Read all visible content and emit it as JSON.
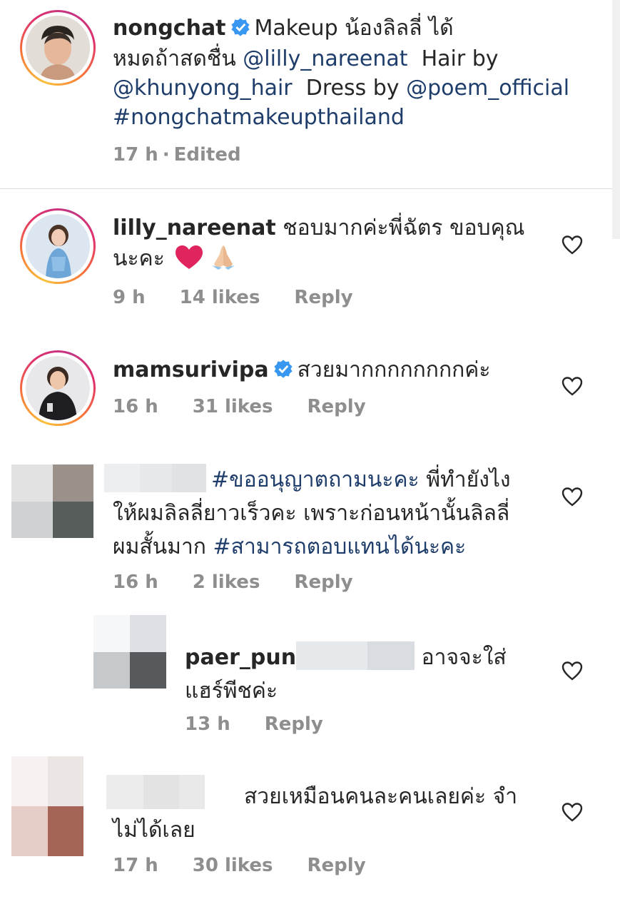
{
  "post": {
    "username": "nongchat",
    "caption_1": "Makeup น้องลิลลี่ ได้",
    "caption_2": "หมดถ้าสดชื่น",
    "mention_1": "@lilly_nareenat",
    "caption_3": "Hair by",
    "mention_2": "@khunyong_hair",
    "caption_4": "Dress by",
    "mention_3": "@poem_official",
    "hashtag": "#nongchatmakeupthailand",
    "time": "17 h",
    "separator": "·",
    "edited": "Edited"
  },
  "comments": [
    {
      "username": "lilly_nareenat",
      "line_1": "ชอบมากค่ะพี่ฉัตร ขอบคุณ",
      "line_2": "นะคะ",
      "emoji_1": "❤️",
      "emoji_2": "🙏🏻",
      "time": "9 h",
      "likes": "14 likes",
      "reply": "Reply"
    },
    {
      "username": "mamsurivipa",
      "text": "สวยมากกกกกกกกค่ะ",
      "time": "16 h",
      "likes": "31 likes",
      "reply": "Reply"
    },
    {
      "hashtag_1": "#ขออนุญาตถามนะคะ",
      "line_1": "พี่ทำยังไง",
      "line_2": "ให้ผมลิลลี่ยาวเร็วคะ เพราะก่อนหน้านั้นลิลลี่",
      "line_3": "ผมสั้นมาก",
      "hashtag_2": "#สามารถตอบแทนได้นะคะ",
      "time": "16 h",
      "likes": "2 likes",
      "reply": "Reply"
    },
    {
      "username": "paer_pun",
      "line_1": "อาจจะใส่",
      "line_2": "แฮร์พีชค่ะ",
      "time": "13 h",
      "reply": "Reply"
    },
    {
      "line_1": "สวยเหมือนคนละคนเลยค่ะ จำ",
      "line_2": "ไม่ได้เลย",
      "time": "17 h",
      "likes": "30 likes",
      "reply": "Reply"
    }
  ],
  "colors": {
    "link": "#1e3d6b",
    "meta": "#8e8e8e",
    "verified": "#3897f0",
    "heart_emoji": "#e0245e",
    "divider": "#dbdbdb"
  },
  "icons": [
    "verified-badge-icon",
    "heart-icon",
    "red-heart-emoji",
    "folded-hands-emoji"
  ]
}
